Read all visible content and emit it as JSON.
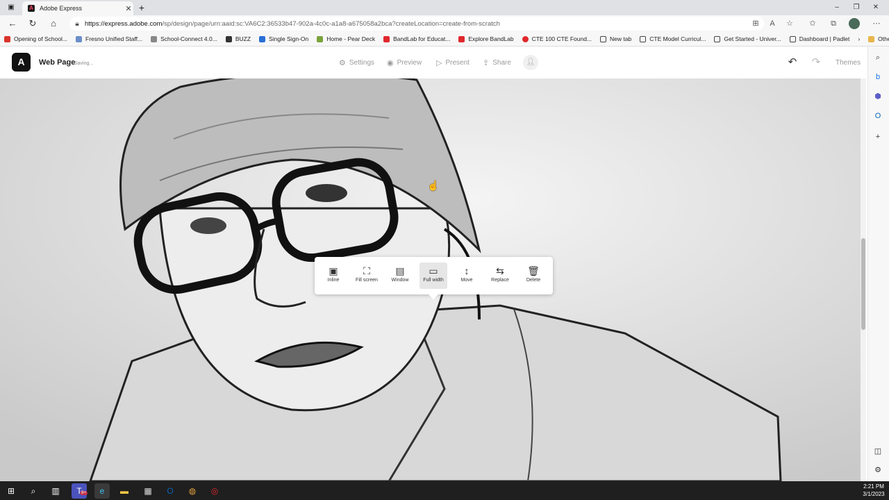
{
  "browser": {
    "tab_title": "Adobe Express",
    "url_host": "https://express.adobe.com",
    "url_path": "/sp/design/page/urn:aaid:sc:VA6C2:36533b47-902a-4c0c-a1a8-a675058a2bca?createLocation=create-from-scratch",
    "bookmarks": [
      {
        "label": "Opening of School...",
        "color": "#d9342b"
      },
      {
        "label": "Fresno Unified Staff...",
        "color": "#6b8ec9"
      },
      {
        "label": "School-Connect 4.0...",
        "color": "#888888"
      },
      {
        "label": "BUZZ",
        "color": "#333333"
      },
      {
        "label": "Single Sign-On",
        "color": "#2a6fd6"
      },
      {
        "label": "Home - Pear Deck",
        "color": "#79a33b"
      },
      {
        "label": "BandLab for Educat...",
        "color": "#e0282d"
      },
      {
        "label": "Explore BandLab",
        "color": "#e0282d"
      },
      {
        "label": "CTE 100 CTE Found...",
        "color": "#e0282d"
      },
      {
        "label": "New tab",
        "color": "#444444"
      },
      {
        "label": "CTE Model Curricul...",
        "color": "#444444"
      },
      {
        "label": "Get Started - Univer...",
        "color": "#444444"
      },
      {
        "label": "Dashboard | Padlet",
        "color": "#444444"
      }
    ],
    "other_favorites": "Other favorites"
  },
  "app": {
    "logo": "A",
    "page_name": "Web Page",
    "status": "Saving...",
    "settings": "Settings",
    "preview": "Preview",
    "present": "Present",
    "share": "Share",
    "themes": "Themes"
  },
  "toolbar": {
    "inline": "Inline",
    "fill_screen": "Fill screen",
    "window": "Window",
    "full_width": "Full width",
    "move": "Move",
    "replace": "Replace",
    "delete": "Delete",
    "selected": "Full width"
  },
  "taskbar": {
    "time": "2:21 PM",
    "date": "3/1/2023",
    "teams_badge": "9+"
  }
}
